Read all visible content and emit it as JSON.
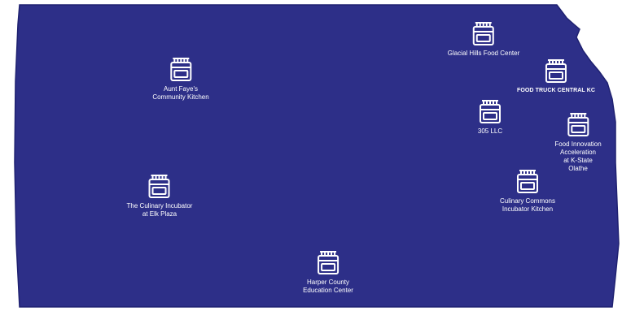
{
  "map": {
    "region_fill": "#2d2f88",
    "region_edge": "#1f2170",
    "label_color": "#ffffff",
    "marker_icon": "stove-icon"
  },
  "kitchens": [
    {
      "id": "aunt-fayes",
      "lines": [
        "Aunt Faye's",
        "Community Kitchen"
      ]
    },
    {
      "id": "glacial-hills",
      "lines": [
        "Glacial Hills Food Center"
      ]
    },
    {
      "id": "food-truck-central",
      "lines": [
        "FOOD TRUCK CENTRAL KC"
      ]
    },
    {
      "id": "305-llc",
      "lines": [
        "305 LLC"
      ]
    },
    {
      "id": "food-innovation",
      "lines": [
        "Food Innovation",
        "Acceleration",
        "at K-State",
        "Olathe"
      ]
    },
    {
      "id": "culinary-commons",
      "lines": [
        "Culinary Commons",
        "Incubator Kitchen"
      ]
    },
    {
      "id": "culinary-incubator-elk",
      "lines": [
        "The Culinary Incubator",
        "at Elk Plaza"
      ]
    },
    {
      "id": "harper-county",
      "lines": [
        "Harper County",
        "Education Center"
      ]
    }
  ]
}
